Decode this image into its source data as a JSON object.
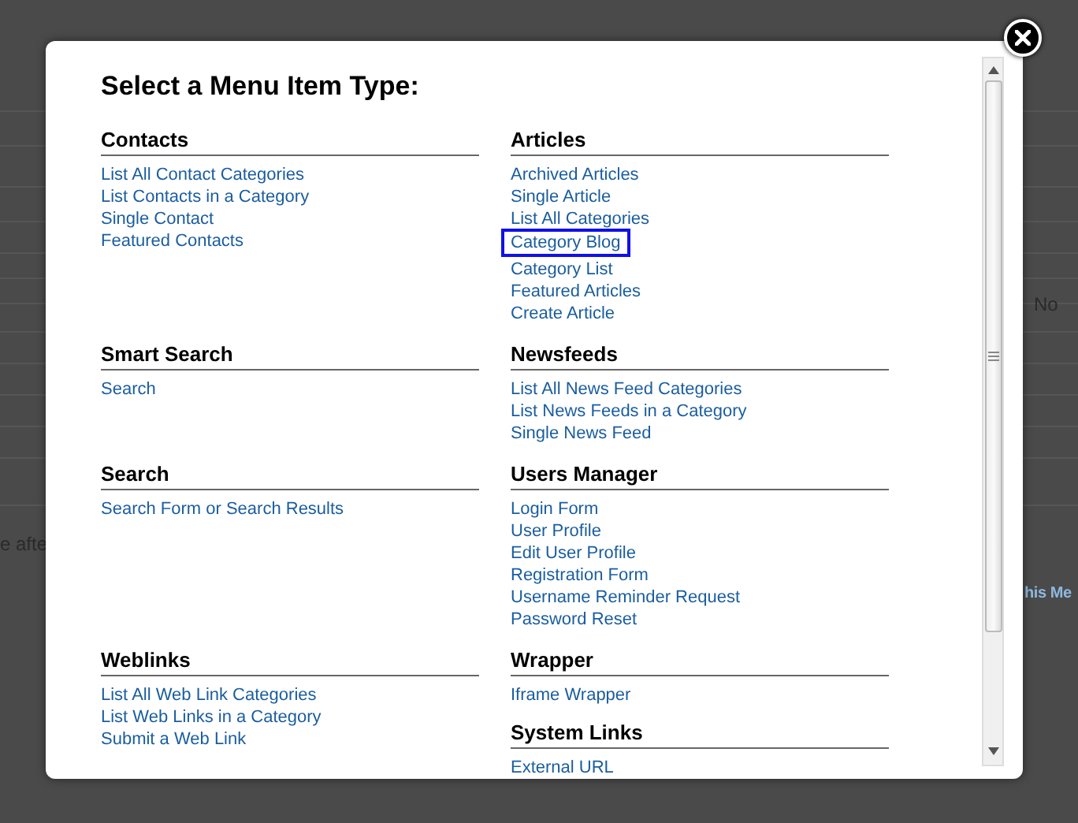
{
  "background": {
    "fragments": [
      {
        "text": "No",
        "kind": "plain"
      },
      {
        "text": "e afte",
        "kind": "plain"
      },
      {
        "text": "his Me",
        "kind": "link"
      }
    ]
  },
  "modal": {
    "title": "Select a Menu Item Type:",
    "sections": [
      {
        "heading": "Contacts",
        "items": [
          {
            "label": "List All Contact Categories",
            "highlighted": false
          },
          {
            "label": "List Contacts in a Category",
            "highlighted": false
          },
          {
            "label": "Single Contact",
            "highlighted": false
          },
          {
            "label": "Featured Contacts",
            "highlighted": false
          }
        ]
      },
      {
        "heading": "Articles",
        "items": [
          {
            "label": "Archived Articles",
            "highlighted": false
          },
          {
            "label": "Single Article",
            "highlighted": false
          },
          {
            "label": "List All Categories",
            "highlighted": false
          },
          {
            "label": "Category Blog",
            "highlighted": true
          },
          {
            "label": "Category List",
            "highlighted": false
          },
          {
            "label": "Featured Articles",
            "highlighted": false
          },
          {
            "label": "Create Article",
            "highlighted": false
          }
        ]
      },
      {
        "heading": "Smart Search",
        "items": [
          {
            "label": "Search",
            "highlighted": false
          }
        ]
      },
      {
        "heading": "Newsfeeds",
        "items": [
          {
            "label": "List All News Feed Categories",
            "highlighted": false
          },
          {
            "label": "List News Feeds in a Category",
            "highlighted": false
          },
          {
            "label": "Single News Feed",
            "highlighted": false
          }
        ]
      },
      {
        "heading": "Search",
        "items": [
          {
            "label": "Search Form or Search Results",
            "highlighted": false
          }
        ]
      },
      {
        "heading": "Users Manager",
        "items": [
          {
            "label": "Login Form",
            "highlighted": false
          },
          {
            "label": "User Profile",
            "highlighted": false
          },
          {
            "label": "Edit User Profile",
            "highlighted": false
          },
          {
            "label": "Registration Form",
            "highlighted": false
          },
          {
            "label": "Username Reminder Request",
            "highlighted": false
          },
          {
            "label": "Password Reset",
            "highlighted": false
          }
        ]
      },
      {
        "heading": "Weblinks",
        "items": [
          {
            "label": "List All Web Link Categories",
            "highlighted": false
          },
          {
            "label": "List Web Links in a Category",
            "highlighted": false
          },
          {
            "label": "Submit a Web Link",
            "highlighted": false
          }
        ]
      },
      {
        "heading": "Wrapper",
        "items": [
          {
            "label": "Iframe Wrapper",
            "highlighted": false
          }
        ]
      },
      {
        "heading": "System Links",
        "items": [
          {
            "label": "External URL",
            "highlighted": false
          }
        ]
      }
    ]
  }
}
